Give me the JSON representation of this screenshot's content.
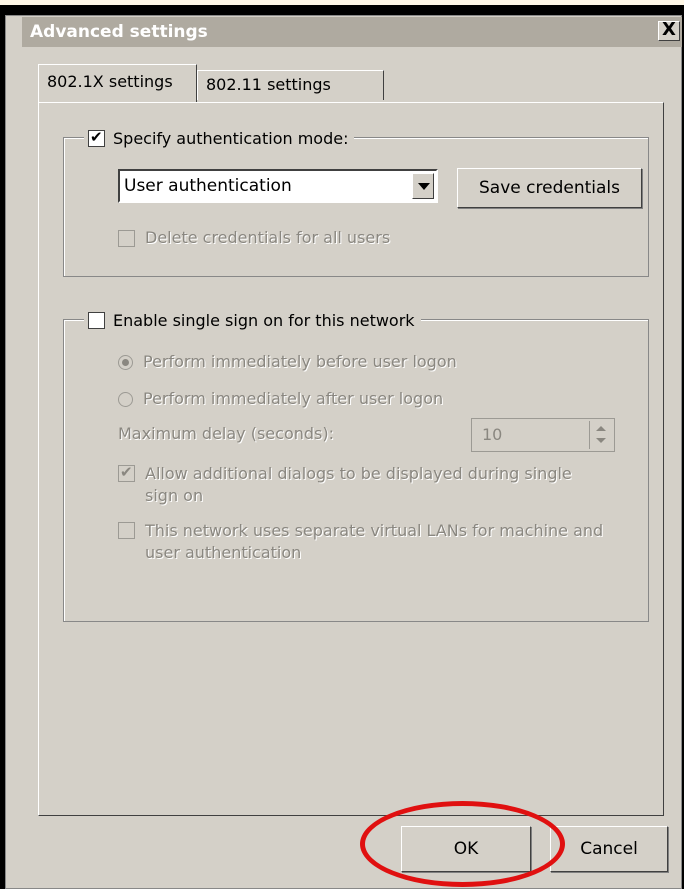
{
  "window": {
    "title": "Advanced settings",
    "close_label": "X"
  },
  "tabs": [
    {
      "label": "802.1X settings",
      "active": true
    },
    {
      "label": "802.11 settings",
      "active": false
    }
  ],
  "auth_group": {
    "checkbox_label": "Specify authentication mode:",
    "checked": true,
    "mode_value": "User authentication",
    "save_credentials_label": "Save credentials",
    "delete_credentials_label": "Delete credentials for all users",
    "delete_credentials_checked": false
  },
  "sso_group": {
    "checkbox_label": "Enable single sign on for this network",
    "checked": false,
    "radio_before_label": "Perform immediately before user logon",
    "radio_after_label": "Perform immediately after user logon",
    "selected_radio": "before",
    "max_delay_label": "Maximum delay (seconds):",
    "max_delay_value": "10",
    "allow_dialogs_label": "Allow additional dialogs to be displayed during single sign on",
    "allow_dialogs_checked": true,
    "vlan_label": "This network uses separate virtual LANs for machine and user authentication",
    "vlan_checked": false
  },
  "footer": {
    "ok_label": "OK",
    "cancel_label": "Cancel"
  },
  "colors": {
    "annotation": "#e01010",
    "dialog_bg": "#d4d0c8",
    "page_bg": "#fff8e7"
  }
}
